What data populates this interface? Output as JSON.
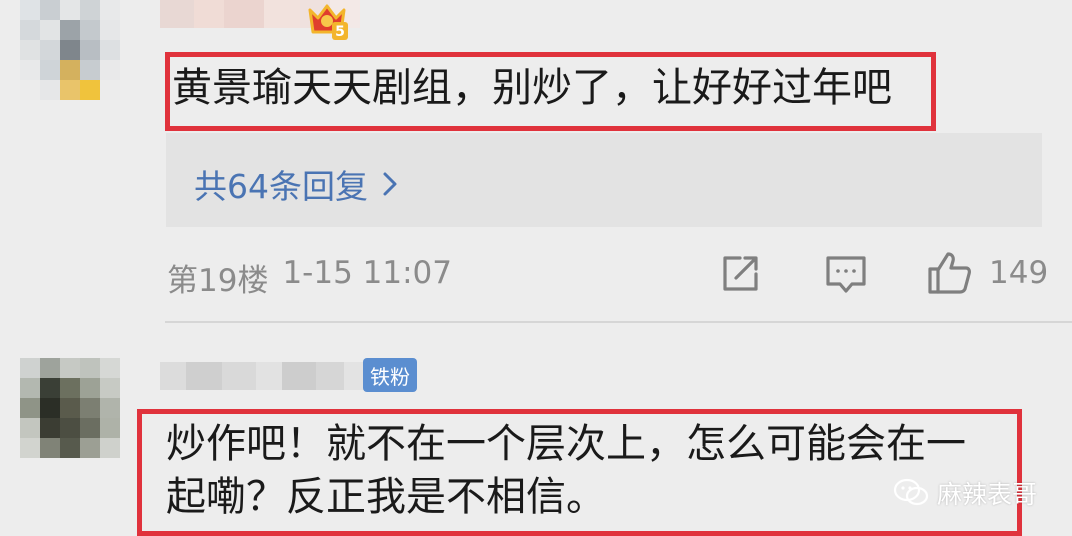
{
  "comment1": {
    "text": "黄景瑜天天剧组，别炒了，让好好过年吧",
    "replies_label": "共64条回复",
    "floor": "第19楼",
    "time": "1-15 11:07",
    "likes": "149",
    "badge_level": "5"
  },
  "comment2": {
    "badge": "铁粉",
    "line1": "炒作吧！就不在一个层次上，怎么可能会在一",
    "line2": "起嘞？反正我是不相信。"
  },
  "watermark": {
    "text": "麻辣表哥"
  },
  "colors": {
    "background": "#ededed",
    "highlight_border": "#e0323c",
    "link": "#4a74b3",
    "badge": "#5b8ed0"
  }
}
